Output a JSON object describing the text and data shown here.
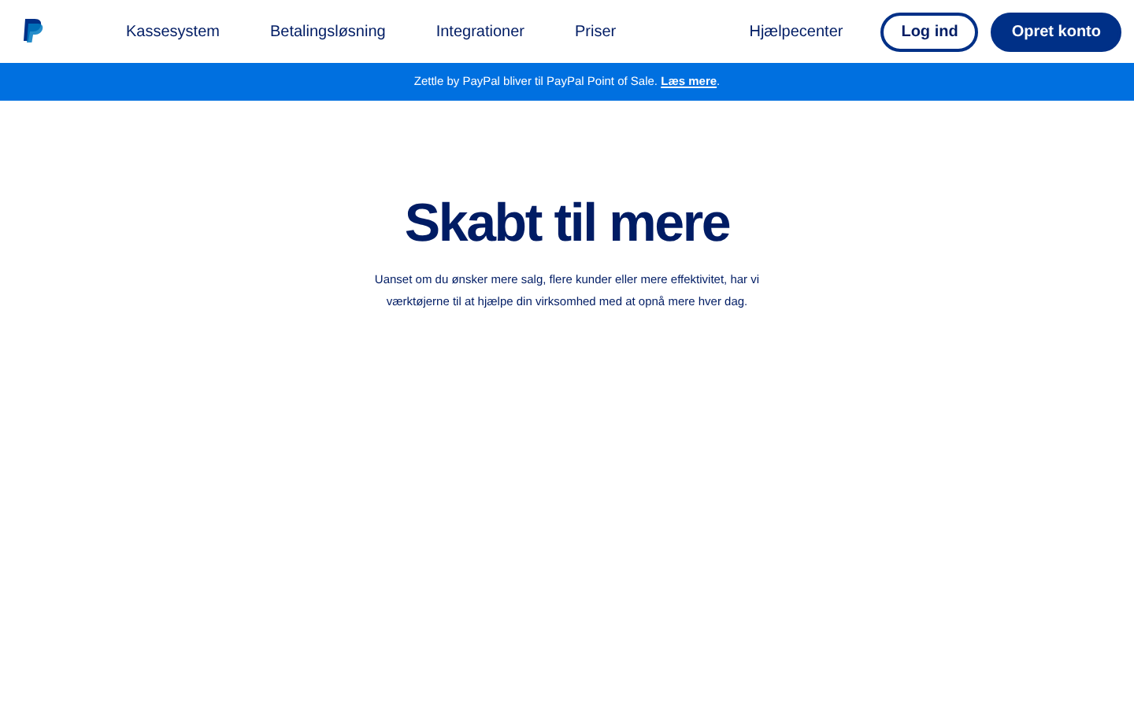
{
  "nav": {
    "items": [
      "Kassesystem",
      "Betalingsløsning",
      "Integrationer",
      "Priser"
    ],
    "help": "Hjælpecenter",
    "buttons": [
      {
        "label": "Log ind",
        "kind": "outline"
      },
      {
        "label": "Opret konto",
        "kind": "filled"
      }
    ]
  },
  "banner": {
    "text": "Zettle by PayPal bliver til PayPal Point of Sale. ",
    "link": "Læs mere",
    "tail": "."
  },
  "hero": {
    "title": "Skabt til mere",
    "subtitle": "Uanset om du ønsker mere salg, flere kunder eller mere effektivitet, har vi værktøjerne til at hjælpe din virksomhed med at opnå mere hver dag."
  }
}
